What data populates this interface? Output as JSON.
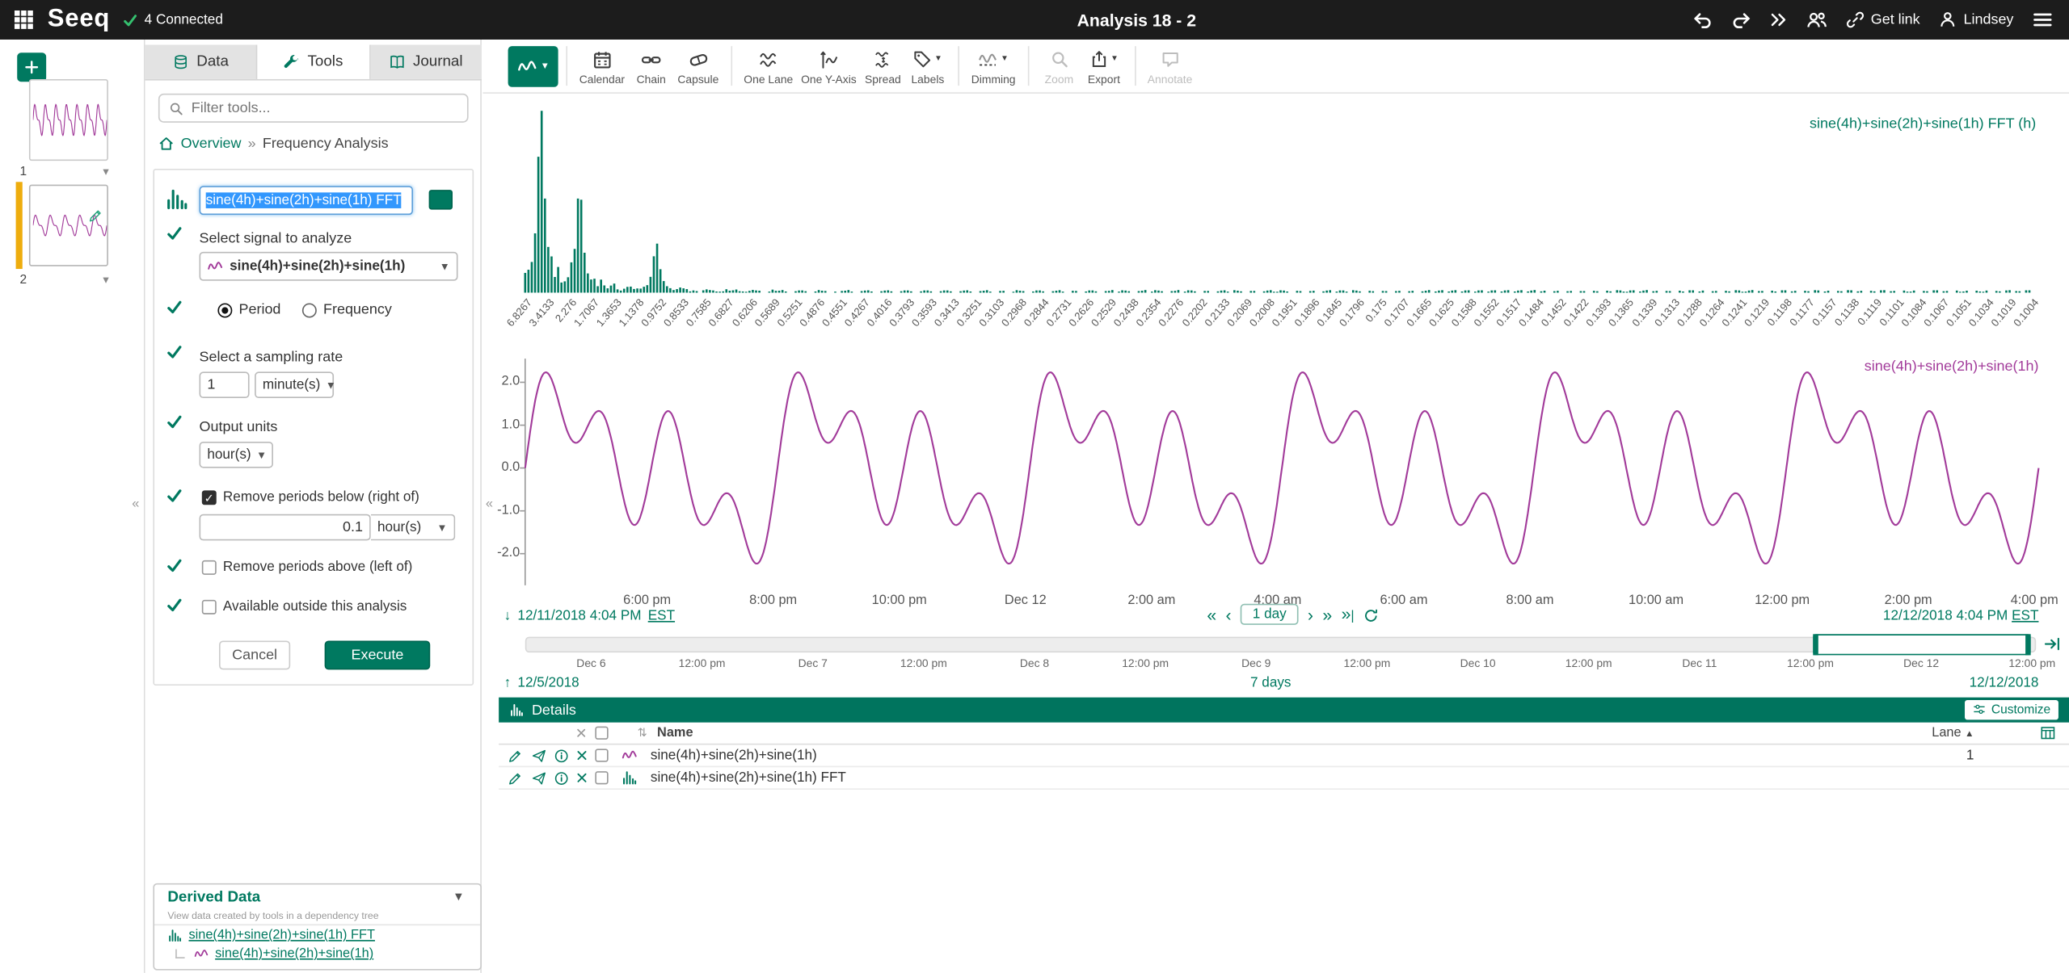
{
  "colors": {
    "primary": "#007960",
    "magenta": "#a23b9a",
    "amber": "#eead0e",
    "selection": "#3297fd"
  },
  "topbar": {
    "brand": "Seeq",
    "connected": "4 Connected",
    "title": "Analysis 18 - 2",
    "get_link": "Get link",
    "user": "Lindsey"
  },
  "worksheets": {
    "items": [
      {
        "number": "1"
      },
      {
        "number": "2"
      }
    ]
  },
  "tools_panel": {
    "tabs": [
      {
        "label": "Data"
      },
      {
        "label": "Tools"
      },
      {
        "label": "Journal"
      }
    ],
    "search_placeholder": "Filter tools...",
    "breadcrumb": {
      "root": "Overview",
      "sep": "»",
      "current": "Frequency Analysis"
    },
    "form": {
      "name_value": "sine(4h)+sine(2h)+sine(1h) FFT",
      "signal_label": "Select signal to analyze",
      "signal_value": "sine(4h)+sine(2h)+sine(1h)",
      "radio_period": "Period",
      "radio_frequency": "Frequency",
      "sampling_label": "Select a sampling rate",
      "sampling_value": "1",
      "sampling_units": "minute(s)",
      "output_label": "Output units",
      "output_units": "hour(s)",
      "below_label": "Remove periods below (right of)",
      "below_value": "0.1",
      "below_units": "hour(s)",
      "above_label": "Remove periods above (left of)",
      "outside_label": "Available outside this analysis",
      "cancel_label": "Cancel",
      "execute_label": "Execute"
    },
    "derived": {
      "title": "Derived Data",
      "subtitle": "View data created by tools in a dependency tree",
      "items": [
        "sine(4h)+sine(2h)+sine(1h) FFT",
        "sine(4h)+sine(2h)+sine(1h)"
      ]
    }
  },
  "toolbar": {
    "buttons": [
      {
        "label": "Calendar"
      },
      {
        "label": "Chain"
      },
      {
        "label": "Capsule"
      },
      {
        "label": "One Lane"
      },
      {
        "label": "One Y-Axis"
      },
      {
        "label": "Spread"
      },
      {
        "label": "Labels"
      },
      {
        "label": "Dimming"
      },
      {
        "label": "Zoom"
      },
      {
        "label": "Export"
      },
      {
        "label": "Annotate"
      }
    ]
  },
  "chart_data": [
    {
      "id": "fft",
      "type": "bar",
      "title": "sine(4h)+sine(2h)+sine(1h) FFT (h)",
      "unit": "h",
      "base_period_h": 6.8267,
      "x_tick_labels": [
        "6.8267",
        "3.4133",
        "2.276",
        "1.7067",
        "1.3653",
        "1.1378",
        "0.9752",
        "0.8533",
        "0.7585",
        "0.6827",
        "0.6206",
        "0.5689",
        "0.5251",
        "0.4876",
        "0.4551",
        "0.4267",
        "0.4016",
        "0.3793",
        "0.3593",
        "0.3413",
        "0.3251",
        "0.3103",
        "0.2968",
        "0.2844",
        "0.2731",
        "0.2626",
        "0.2529",
        "0.2438",
        "0.2354",
        "0.2276",
        "0.2202",
        "0.2133",
        "0.2069",
        "0.2008",
        "0.1951",
        "0.1896",
        "0.1845",
        "0.1796",
        "0.175",
        "0.1707",
        "0.1665",
        "0.1625",
        "0.1588",
        "0.1552",
        "0.1517",
        "0.1484",
        "0.1452",
        "0.1422",
        "0.1393",
        "0.1365",
        "0.1339",
        "0.1313",
        "0.1288",
        "0.1264",
        "0.1241",
        "0.1219",
        "0.1198",
        "0.1177",
        "0.1157",
        "0.1138",
        "0.1119",
        "0.1101",
        "0.1084",
        "0.1067",
        "0.1051",
        "0.1034",
        "0.1019",
        "0.1004"
      ],
      "peaks": [
        {
          "period_h": 4,
          "rel_height": 1.0
        },
        {
          "period_h": 2,
          "rel_height": 0.58
        },
        {
          "period_h": 1,
          "rel_height": 0.27
        }
      ],
      "color": "#007960"
    },
    {
      "id": "trend",
      "type": "line",
      "series": [
        {
          "name": "sine(4h)+sine(2h)+sine(1h)",
          "color": "#a23b9a",
          "component_periods_h": [
            4,
            2,
            1
          ]
        }
      ],
      "y_ticks": [
        "2.0",
        "1.0",
        "0.0",
        "-1.0",
        "-2.0"
      ],
      "y_range": [
        -2.6,
        2.6
      ],
      "x_tick_labels": [
        "6:00 pm",
        "8:00 pm",
        "10:00 pm",
        "Dec 12",
        "2:00 am",
        "4:00 am",
        "6:00 am",
        "8:00 am",
        "10:00 am",
        "12:00 pm",
        "2:00 pm",
        "4:00 pm"
      ],
      "x_start": "12/11/2018 4:04 PM EST",
      "x_end": "12/12/2018 4:04 PM EST"
    }
  ],
  "trend_nav": {
    "start": "12/11/2018 4:04 PM",
    "start_tz": "EST",
    "duration": "1 day",
    "end": "12/12/2018 4:04 PM",
    "end_tz": "EST"
  },
  "scrubber": {
    "tick_labels": [
      "Dec 6",
      "12:00 pm",
      "Dec 7",
      "12:00 pm",
      "Dec 8",
      "12:00 pm",
      "Dec 9",
      "12:00 pm",
      "Dec 10",
      "12:00 pm",
      "Dec 11",
      "12:00 pm",
      "Dec 12",
      "12:00 pm"
    ],
    "range_start": "12/5/2018",
    "range_duration": "7 days",
    "range_end": "12/12/2018"
  },
  "details": {
    "title": "Details",
    "customize_label": "Customize",
    "columns": {
      "name": "Name",
      "lane": "Lane"
    },
    "rows": [
      {
        "name": "sine(4h)+sine(2h)+sine(1h)",
        "lane": "1",
        "icon": "signal"
      },
      {
        "name": "sine(4h)+sine(2h)+sine(1h) FFT",
        "lane": "",
        "icon": "fft"
      }
    ]
  }
}
